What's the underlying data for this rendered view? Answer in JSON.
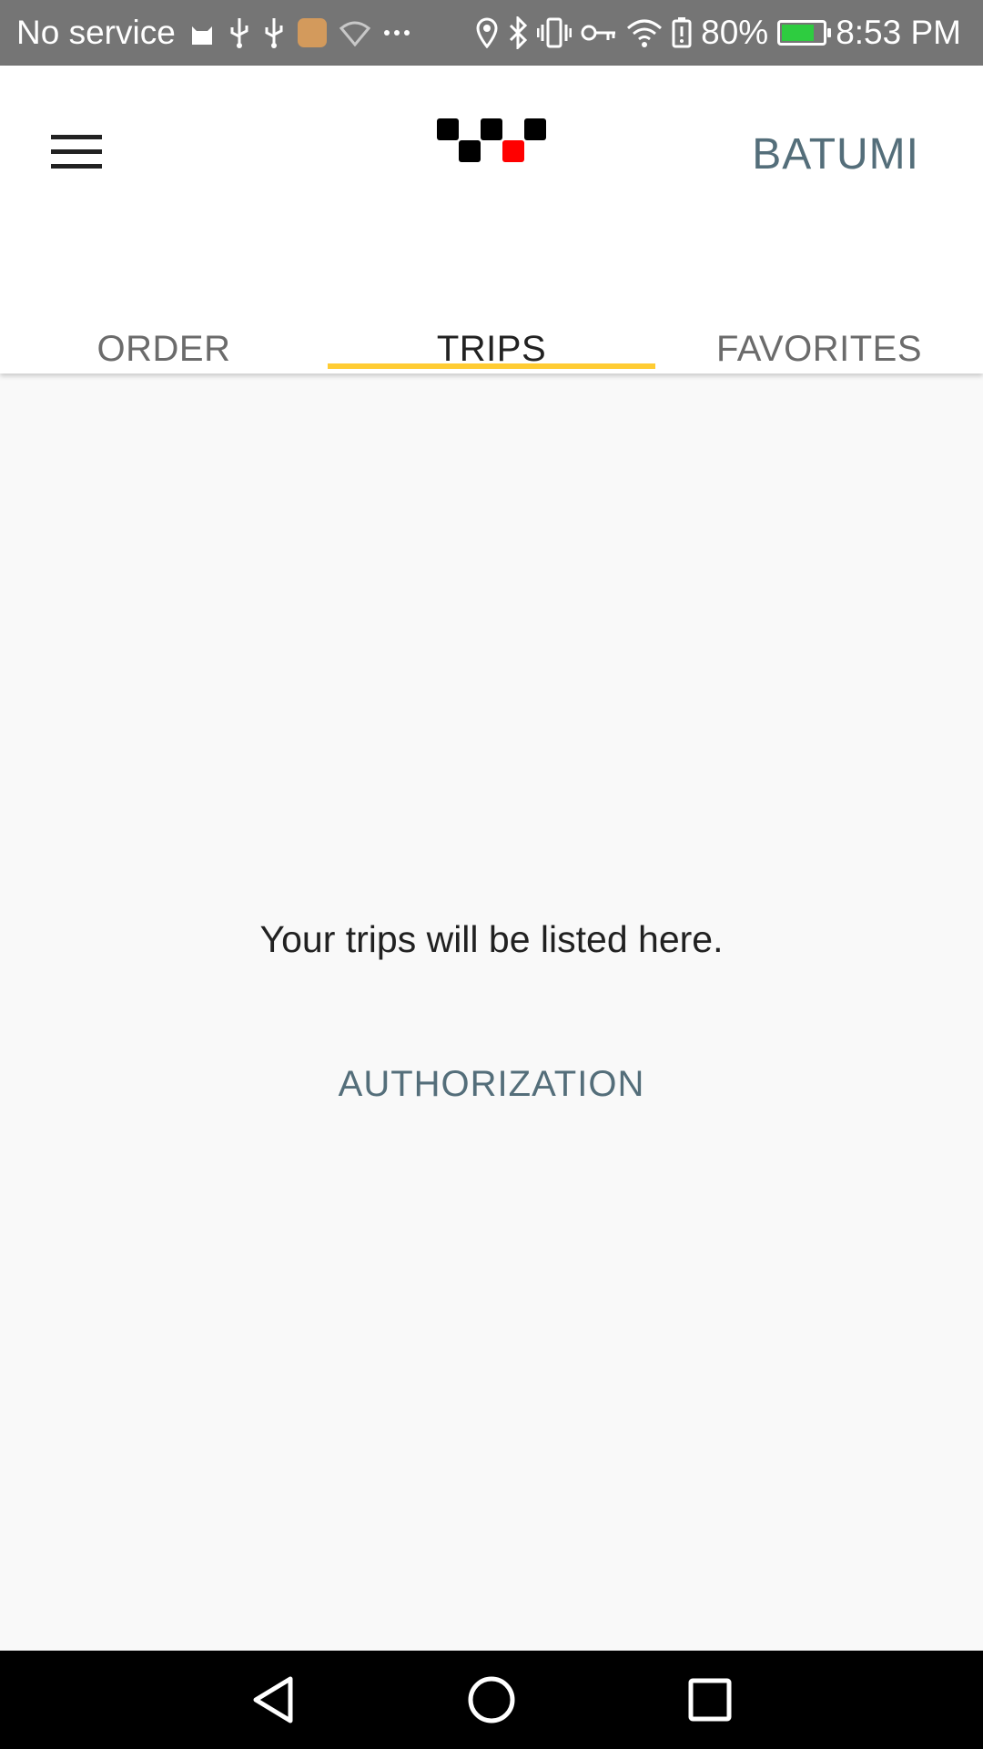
{
  "status_bar": {
    "carrier": "No service",
    "battery_percent_text": "80%",
    "battery_level": 0.8,
    "time": "8:53 PM",
    "icons_left": [
      "cat-icon",
      "usb-icon",
      "usb-icon",
      "app-icon",
      "wifi-question-icon",
      "more-dots-icon"
    ],
    "icons_right": [
      "location-icon",
      "bluetooth-icon",
      "vibrate-icon",
      "key-icon",
      "wifi-icon",
      "battery-alert-icon",
      "battery-charging-icon"
    ]
  },
  "header": {
    "menu_icon": "hamburger-menu-icon",
    "logo_icon": "taxi-checker-logo",
    "city": "BATUMI"
  },
  "tabs": [
    {
      "label": "ORDER",
      "active": false
    },
    {
      "label": "TRIPS",
      "active": true
    },
    {
      "label": "FAVORITES",
      "active": false
    }
  ],
  "main": {
    "empty_message": "Your trips will be listed here.",
    "auth_button": "AUTHORIZATION"
  },
  "nav_bar": {
    "icons": [
      "back-icon",
      "home-icon",
      "recents-icon"
    ]
  },
  "colors": {
    "status_bar": "#757575",
    "accent_yellow": "#ffcc33",
    "link_blue_grey": "#546e7a",
    "logo_red": "#ff0000",
    "background": "#f9f9f9"
  }
}
